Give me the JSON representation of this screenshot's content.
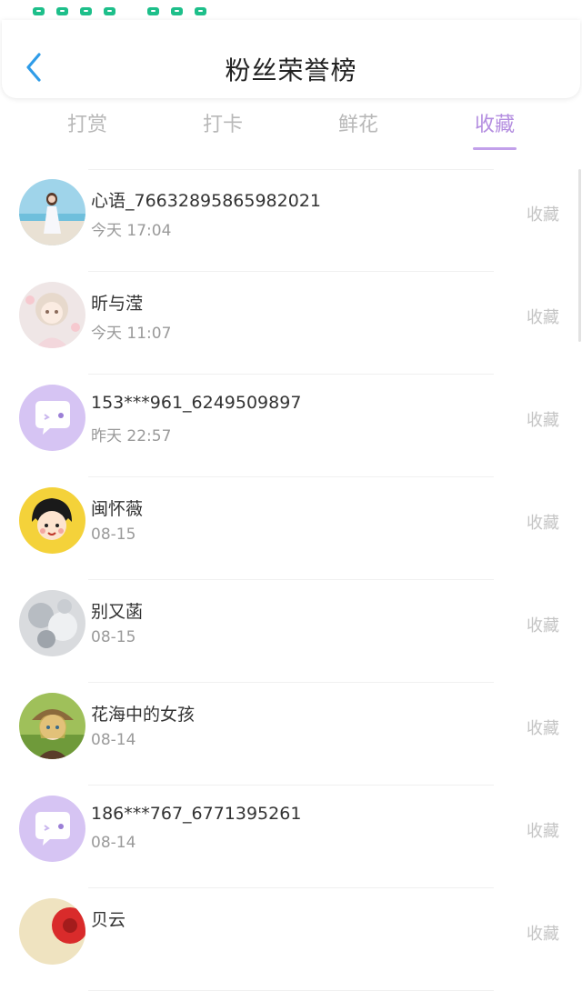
{
  "header": {
    "title": "粉丝荣誉榜"
  },
  "tabs": [
    {
      "label": "打赏"
    },
    {
      "label": "打卡"
    },
    {
      "label": "鲜花"
    },
    {
      "label": "收藏",
      "active": true
    }
  ],
  "rows": [
    {
      "name": "心语_76632895865982021",
      "time": "今天 17:04",
      "action": "收藏",
      "avatar": "photo-girl-beach"
    },
    {
      "name": "昕与滢",
      "time": "今天 11:07",
      "action": "收藏",
      "avatar": "anime-girl-pastel"
    },
    {
      "name": "153***961_6249509897",
      "time": "昨天 22:57",
      "action": "收藏",
      "avatar": "default-chat-bubble"
    },
    {
      "name": "闽怀薇",
      "time": "08-15",
      "action": "收藏",
      "avatar": "cartoon-girl-yellow"
    },
    {
      "name": "别又菡",
      "time": "08-15",
      "action": "收藏",
      "avatar": "grey-flowers"
    },
    {
      "name": "花海中的女孩",
      "time": "08-14",
      "action": "收藏",
      "avatar": "anime-girl-hat"
    },
    {
      "name": "186***767_6771395261",
      "time": "08-14",
      "action": "收藏",
      "avatar": "default-chat-bubble"
    },
    {
      "name": "贝云",
      "time": "",
      "action": "收藏",
      "avatar": "red-flower"
    }
  ],
  "colors": {
    "accent": "#b48ee0",
    "back_arrow": "#2f9ce8",
    "inactive_tab": "#b8b8b8",
    "default_avatar_bg": "#d6c4f3"
  }
}
